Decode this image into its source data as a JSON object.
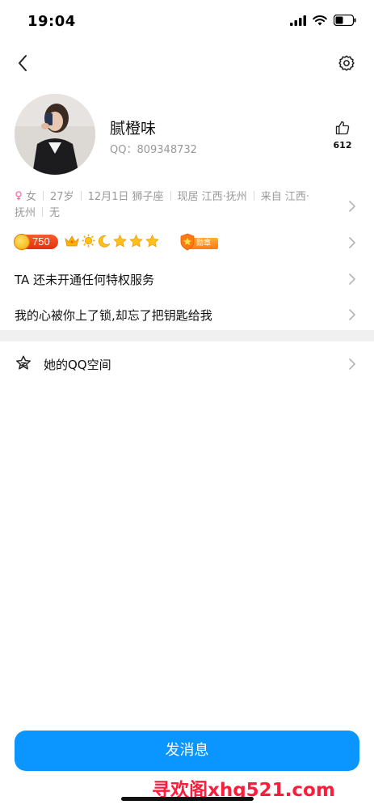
{
  "status_bar": {
    "time": "19:04"
  },
  "profile": {
    "nickname": "腻橙味",
    "qq_label": "QQ：809348732",
    "like_count": "612"
  },
  "info": {
    "gender": "女",
    "age": "27岁",
    "birthday": "12月1日 狮子座",
    "residence": "现居 江西·抚州",
    "hometown_line1": "来自 江西·",
    "hometown_line2": "抚州",
    "extra": "无"
  },
  "badges": {
    "level": "750",
    "medal_label": "勋章"
  },
  "rows": {
    "privilege": "TA 还未开通任何特权服务",
    "signature": "我的心被你上了锁,却忘了把钥匙给我",
    "qzone": "她的QQ空间"
  },
  "actions": {
    "send_message": "发消息"
  },
  "watermark": "寻欢阁xhg521.com",
  "colors": {
    "accent": "#0b96ff",
    "watermark": "#ff1b3b",
    "level_pill": "#e0320e"
  }
}
